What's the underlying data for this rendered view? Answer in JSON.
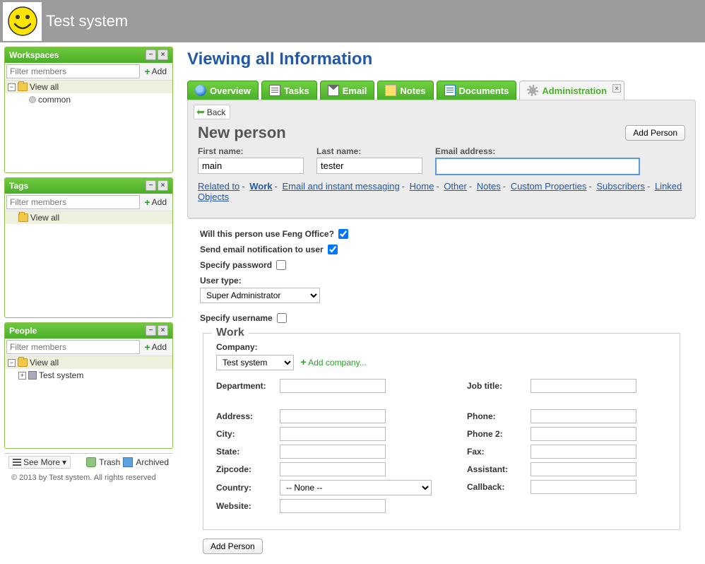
{
  "header": {
    "title": "Test system"
  },
  "sidebar": {
    "workspaces": {
      "title": "Workspaces",
      "filter_placeholder": "Filter members",
      "add": "Add",
      "view_all": "View all",
      "items": [
        "common"
      ]
    },
    "tags": {
      "title": "Tags",
      "filter_placeholder": "Filter members",
      "add": "Add",
      "view_all": "View all"
    },
    "people": {
      "title": "People",
      "filter_placeholder": "Filter members",
      "add": "Add",
      "view_all": "View all",
      "items": [
        "Test system"
      ]
    },
    "bottom": {
      "see_more": "See More",
      "trash": "Trash",
      "archived": "Archived"
    }
  },
  "footer": "© 2013 by Test system. All rights reserved",
  "tabs": [
    {
      "label": "Overview",
      "icon": "globe"
    },
    {
      "label": "Tasks",
      "icon": "tasks"
    },
    {
      "label": "Email",
      "icon": "email"
    },
    {
      "label": "Notes",
      "icon": "notes"
    },
    {
      "label": "Documents",
      "icon": "docs"
    },
    {
      "label": "Administration",
      "icon": "gear",
      "active": true
    }
  ],
  "page_title": "Viewing all Information",
  "back": "Back",
  "form": {
    "title": "New person",
    "add_button": "Add Person",
    "first_name_label": "First name:",
    "first_name": "main",
    "last_name_label": "Last name:",
    "last_name": "tester",
    "email_label": "Email address:",
    "email": ""
  },
  "nav_links": {
    "related": "Related to",
    "work": "Work",
    "eim": "Email and instant messaging",
    "home": "Home",
    "other": "Other",
    "notes": "Notes",
    "custom": "Custom Properties",
    "subs": "Subscribers",
    "linked": "Linked Objects"
  },
  "options": {
    "use_feng": {
      "label": "Will this person use Feng Office?",
      "checked": true
    },
    "send_email": {
      "label": "Send email notification to user",
      "checked": true
    },
    "specify_pw": {
      "label": "Specify password",
      "checked": false
    },
    "user_type_label": "User type:",
    "user_type": "Super Administrator",
    "specify_un": {
      "label": "Specify username",
      "checked": false
    }
  },
  "work": {
    "legend": "Work",
    "company_label": "Company:",
    "company": "Test system",
    "add_company": "Add company...",
    "department_label": "Department:",
    "job_title_label": "Job title:",
    "address_label": "Address:",
    "city_label": "City:",
    "state_label": "State:",
    "zipcode_label": "Zipcode:",
    "country_label": "Country:",
    "country": "-- None --",
    "website_label": "Website:",
    "phone_label": "Phone:",
    "phone2_label": "Phone 2:",
    "fax_label": "Fax:",
    "assistant_label": "Assistant:",
    "callback_label": "Callback:"
  }
}
